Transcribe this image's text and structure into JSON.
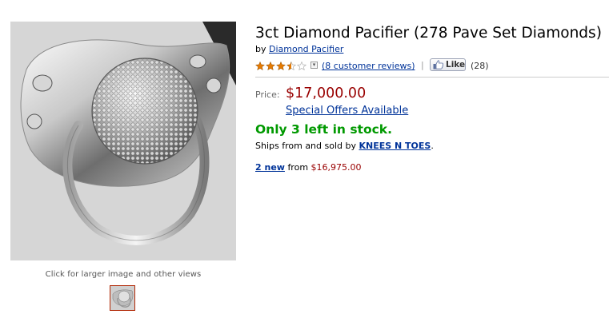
{
  "image": {
    "caption": "Click for larger image and other views"
  },
  "product": {
    "title": "3ct Diamond Pacifier (278 Pave Set Diamonds)",
    "by_prefix": "by",
    "brand": "Diamond Pacifier",
    "rating": 3.5,
    "rating_max": 5,
    "reviews": "(8 customer reviews)",
    "separator": "|",
    "like_label": "Like",
    "like_count": "(28)"
  },
  "pricing": {
    "price_label": "Price:",
    "price": "$17,000.00",
    "offers_link": "Special Offers Available"
  },
  "availability": {
    "stock": "Only 3 left in stock.",
    "ships_text": "Ships from and sold by",
    "seller": "KNEES N TOES",
    "ships_end": "."
  },
  "offers": {
    "new_link": "2 new",
    "from_text": "from",
    "new_price": "$16,975.00"
  },
  "colors": {
    "link": "#003399",
    "price": "#990000",
    "stock": "#009900",
    "star": "#e67a00"
  }
}
